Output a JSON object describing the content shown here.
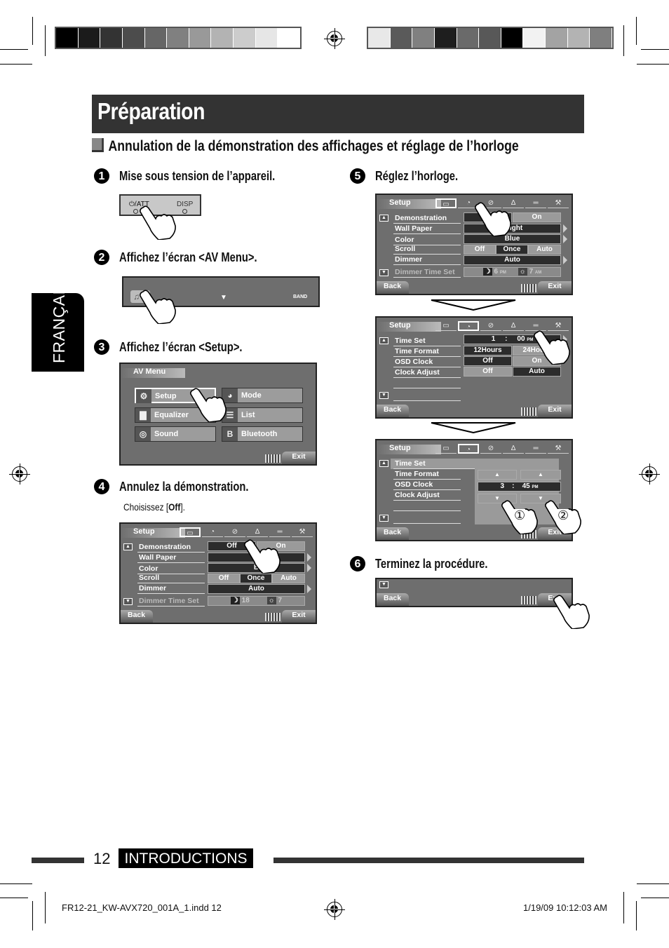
{
  "color_bars": {
    "left": [
      "#000000",
      "#1b1b1b",
      "#333333",
      "#4c4c4c",
      "#666666",
      "#808080",
      "#999999",
      "#b3b3b3",
      "#cccccc",
      "#e6e6e6",
      "#ffffff"
    ],
    "right": [
      "#e8e8e8",
      "#5a5a5a",
      "#808080",
      "#1e1e1e",
      "#6a6a6a",
      "#585858",
      "#000000",
      "#f2f2f2",
      "#a3a3a3",
      "#b3b3b3",
      "#7f7f7f"
    ]
  },
  "page": {
    "title": "Préparation",
    "section_title": "Annulation de la démonstration des affichages et réglage de l’horloge",
    "language_tab": "FRANÇAIS"
  },
  "steps": [
    {
      "num": "1",
      "title": "Mise sous tension de l’appareil."
    },
    {
      "num": "2",
      "title": "Affichez l’écran <AV Menu>."
    },
    {
      "num": "3",
      "title": "Affichez l’écran <Setup>."
    },
    {
      "num": "4",
      "title": "Annulez la démonstration.",
      "note_prefix": "Choisissez [",
      "note_bold": "Off",
      "note_suffix": "]."
    },
    {
      "num": "5",
      "title": "Réglez l’horloge."
    },
    {
      "num": "6",
      "title": "Terminez la procédure."
    }
  ],
  "panel1": {
    "att_label": "⏻/ATT",
    "disp_label": "DISP"
  },
  "panel2": {
    "band_label": "BAND",
    "down_arrow": "▼"
  },
  "av_menu": {
    "title": "AV Menu",
    "items": [
      {
        "label": "Setup",
        "icon": "gear-icon",
        "glyph": "⚙"
      },
      {
        "label": "Mode",
        "icon": "mode-icon",
        "glyph": "◕"
      },
      {
        "label": "Equalizer",
        "icon": "equalizer-icon",
        "glyph": "▇"
      },
      {
        "label": "List",
        "icon": "list-icon",
        "glyph": "☰"
      },
      {
        "label": "Sound",
        "icon": "sound-icon",
        "glyph": "◎"
      },
      {
        "label": "Bluetooth",
        "icon": "bluetooth-icon",
        "glyph": "B"
      }
    ],
    "exit": "Exit"
  },
  "setup_common": {
    "title": "Setup",
    "tabs": [
      {
        "icon": "display-tab-icon",
        "glyph": "▭"
      },
      {
        "icon": "clock-tab-icon",
        "glyph": "◔"
      },
      {
        "icon": "disc-tab-icon",
        "glyph": "⊘"
      },
      {
        "icon": "sound-tab-icon",
        "glyph": "∆"
      },
      {
        "icon": "input-tab-icon",
        "glyph": "═"
      },
      {
        "icon": "wrench-tab-icon",
        "glyph": "⚒"
      }
    ],
    "back": "Back",
    "exit": "Exit"
  },
  "setup_display": {
    "rows": [
      "Demonstration",
      "Wall Paper",
      "Color",
      "Scroll",
      "Dimmer",
      "Dimmer Time Set"
    ],
    "demonstration": [
      "Off",
      "On"
    ],
    "wall_paper": "Bright",
    "color": "Blue",
    "scroll": [
      "Off",
      "Once",
      "Auto"
    ],
    "dimmer": "Auto",
    "dimmer_time_step4": {
      "off_time": "18",
      "on_time": "7"
    },
    "dimmer_time_step5": {
      "off_time": "6",
      "off_suffix": "PM",
      "on_time": "7",
      "on_suffix": "AM"
    },
    "wall_paper_partial": "B",
    "color_partial": "B"
  },
  "setup_clock": {
    "rows": [
      "Time Set",
      "Time Format",
      "OSD Clock",
      "Clock Adjust"
    ],
    "time_hour": "1",
    "time_sep": ":",
    "time_min": "00",
    "time_suffix": "PM",
    "time_format": [
      "12Hours",
      "24Hours"
    ],
    "osd_clock": [
      "Off",
      "On"
    ],
    "clock_adjust": [
      "Off",
      "Auto"
    ]
  },
  "time_set": {
    "hour": "3",
    "sep": ":",
    "min": "45",
    "suffix": "PM",
    "callouts": [
      "①",
      "②"
    ]
  },
  "footer": {
    "page_number": "12",
    "section": "INTRODUCTIONS",
    "slug_file": "FR12-21_KW-AVX720_001A_1.indd   12",
    "slug_date": "1/19/09   10:12:03 AM"
  }
}
